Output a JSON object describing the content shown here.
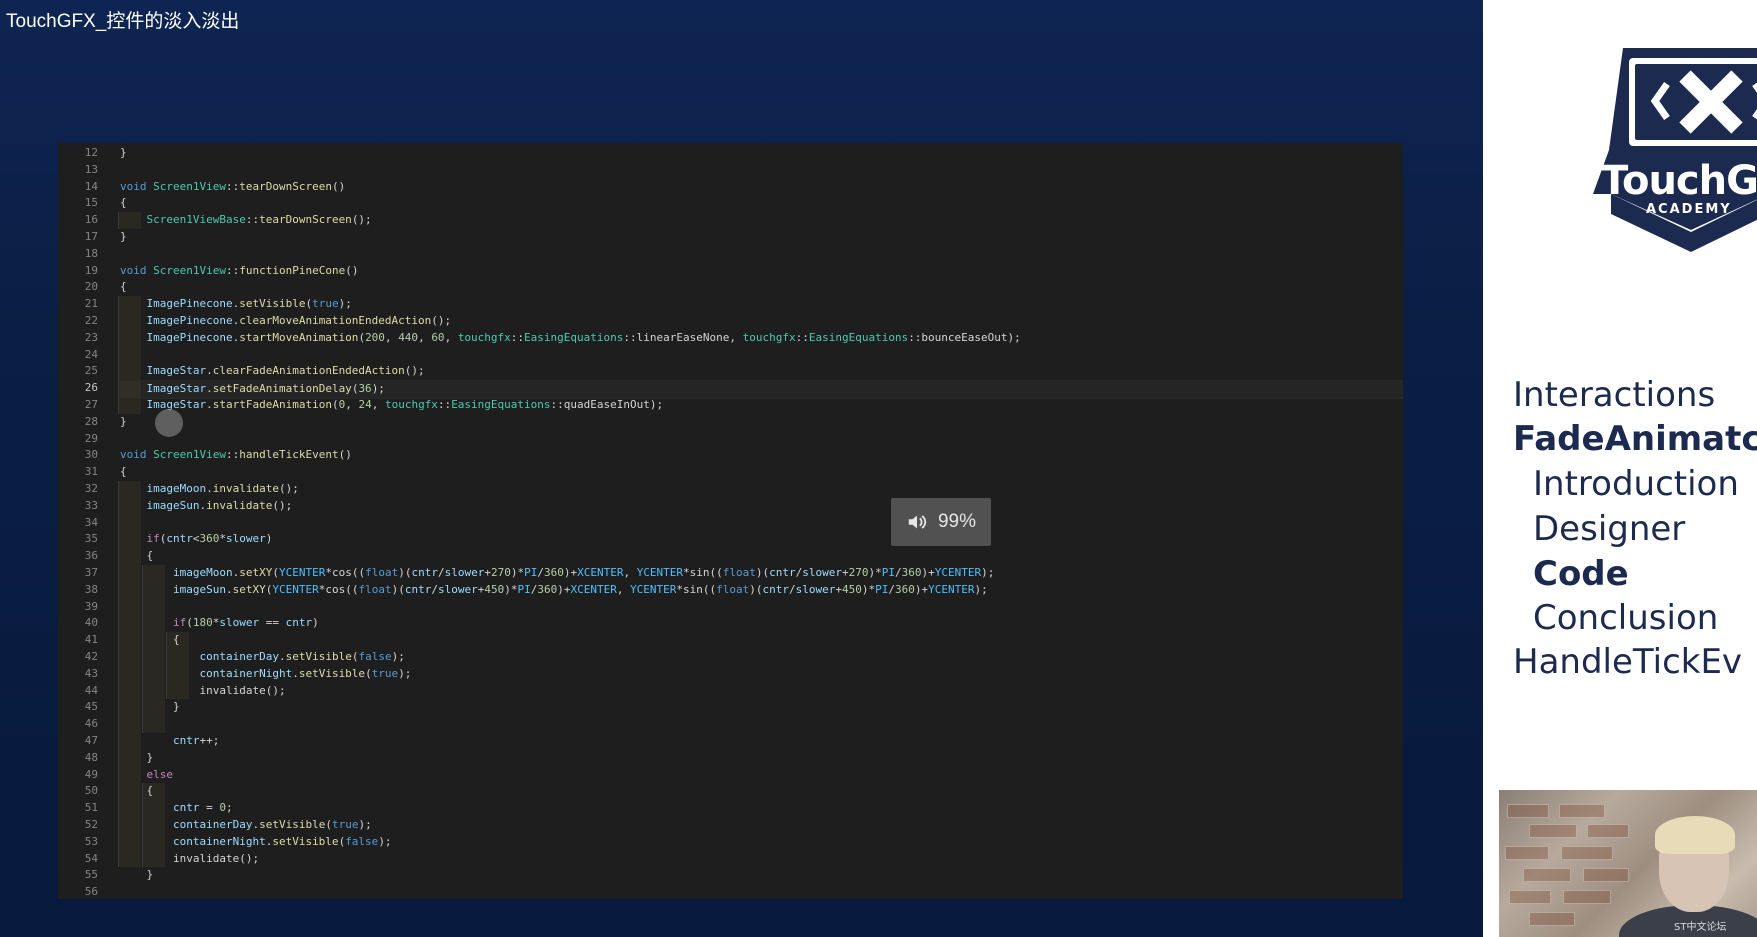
{
  "video": {
    "title": "TouchGFX_控件的淡入淡出",
    "volume_label": "99%"
  },
  "editor": {
    "lines": [
      {
        "n": "12",
        "t": "}"
      },
      {
        "n": "13",
        "t": ""
      },
      {
        "n": "14",
        "t": "void Screen1View::tearDownScreen()"
      },
      {
        "n": "15",
        "t": "{"
      },
      {
        "n": "16",
        "t": "    Screen1ViewBase::tearDownScreen();"
      },
      {
        "n": "17",
        "t": "}"
      },
      {
        "n": "18",
        "t": ""
      },
      {
        "n": "19",
        "t": "void Screen1View::functionPineCone()"
      },
      {
        "n": "20",
        "t": "{"
      },
      {
        "n": "21",
        "t": "    ImagePinecone.setVisible(true);"
      },
      {
        "n": "22",
        "t": "    ImagePinecone.clearMoveAnimationEndedAction();"
      },
      {
        "n": "23",
        "t": "    ImagePinecone.startMoveAnimation(200, 440, 60, touchgfx::EasingEquations::linearEaseNone, touchgfx::EasingEquations::bounceEaseOut);"
      },
      {
        "n": "24",
        "t": ""
      },
      {
        "n": "25",
        "t": "    ImageStar.clearFadeAnimationEndedAction();"
      },
      {
        "n": "26",
        "t": "    ImageStar.setFadeAnimationDelay(36);"
      },
      {
        "n": "27",
        "t": "    ImageStar.startFadeAnimation(0, 24, touchgfx::EasingEquations::quadEaseInOut);"
      },
      {
        "n": "28",
        "t": "}"
      },
      {
        "n": "29",
        "t": ""
      },
      {
        "n": "30",
        "t": "void Screen1View::handleTickEvent()"
      },
      {
        "n": "31",
        "t": "{"
      },
      {
        "n": "32",
        "t": "    imageMoon.invalidate();"
      },
      {
        "n": "33",
        "t": "    imageSun.invalidate();"
      },
      {
        "n": "34",
        "t": ""
      },
      {
        "n": "35",
        "t": "    if(cntr<360*slower)"
      },
      {
        "n": "36",
        "t": "    {"
      },
      {
        "n": "37",
        "t": "        imageMoon.setXY(YCENTER*cos((float)(cntr/slower+270)*PI/360)+XCENTER, YCENTER*sin((float)(cntr/slower+270)*PI/360)+YCENTER);"
      },
      {
        "n": "38",
        "t": "        imageSun.setXY(YCENTER*cos((float)(cntr/slower+450)*PI/360)+XCENTER, YCENTER*sin((float)(cntr/slower+450)*PI/360)+YCENTER);"
      },
      {
        "n": "39",
        "t": ""
      },
      {
        "n": "40",
        "t": "        if(180*slower == cntr)"
      },
      {
        "n": "41",
        "t": "        {"
      },
      {
        "n": "42",
        "t": "            containerDay.setVisible(false);"
      },
      {
        "n": "43",
        "t": "            containerNight.setVisible(true);"
      },
      {
        "n": "44",
        "t": "            invalidate();"
      },
      {
        "n": "45",
        "t": "        }"
      },
      {
        "n": "46",
        "t": ""
      },
      {
        "n": "47",
        "t": "        cntr++;"
      },
      {
        "n": "48",
        "t": "    }"
      },
      {
        "n": "49",
        "t": "    else"
      },
      {
        "n": "50",
        "t": "    {"
      },
      {
        "n": "51",
        "t": "        cntr = 0;"
      },
      {
        "n": "52",
        "t": "        containerDay.setVisible(true);"
      },
      {
        "n": "53",
        "t": "        containerNight.setVisible(false);"
      },
      {
        "n": "54",
        "t": "        invalidate();"
      },
      {
        "n": "55",
        "t": "    }"
      },
      {
        "n": "56",
        "t": ""
      }
    ],
    "active_line": "26"
  },
  "sidebar": {
    "logo_text": "TouchGFX",
    "logo_sub": "ACADEMY",
    "agenda": [
      {
        "label": "Interactions",
        "style": "normal"
      },
      {
        "label": "FadeAnimatc",
        "style": "bold"
      },
      {
        "label": "Introduction",
        "style": "sub"
      },
      {
        "label": "Designer",
        "style": "sub"
      },
      {
        "label": "Code",
        "style": "sub-bold"
      },
      {
        "label": "Conclusion",
        "style": "sub"
      },
      {
        "label": "HandleTickEv",
        "style": "normal"
      }
    ],
    "watermark": "ST中文论坛"
  },
  "colors": {
    "video_bg": "#0b1f45",
    "editor_bg": "#1e1e1e",
    "agenda_text": "#1b2a4e",
    "logo_navy": "#1b2a4e"
  }
}
